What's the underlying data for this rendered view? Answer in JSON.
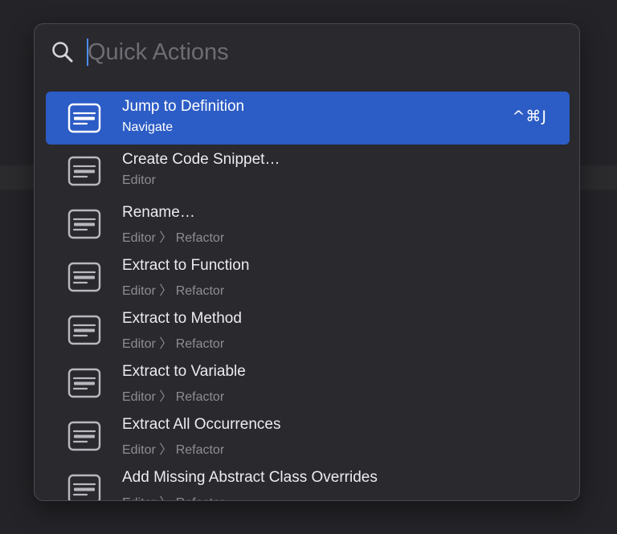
{
  "search": {
    "placeholder": "Quick Actions",
    "icon": "magnifier-icon"
  },
  "colors": {
    "selection": "#2c5cc5",
    "caret": "#4a8ef5",
    "panel": "#2a292e"
  },
  "items": [
    {
      "title": "Jump to Definition",
      "subtitle": "Navigate",
      "shortcut": "^⌘J",
      "selected": true,
      "icon": "command-icon"
    },
    {
      "title": "Create Code Snippet…",
      "subtitle": "Editor",
      "shortcut": "",
      "selected": false,
      "icon": "command-icon"
    },
    {
      "title": "Rename…",
      "subtitle": "Editor 〉 Refactor",
      "shortcut": "",
      "selected": false,
      "icon": "command-icon"
    },
    {
      "title": "Extract to Function",
      "subtitle": "Editor 〉 Refactor",
      "shortcut": "",
      "selected": false,
      "icon": "command-icon"
    },
    {
      "title": "Extract to Method",
      "subtitle": "Editor 〉 Refactor",
      "shortcut": "",
      "selected": false,
      "icon": "command-icon"
    },
    {
      "title": "Extract to Variable",
      "subtitle": "Editor 〉 Refactor",
      "shortcut": "",
      "selected": false,
      "icon": "command-icon"
    },
    {
      "title": "Extract All Occurrences",
      "subtitle": "Editor 〉 Refactor",
      "shortcut": "",
      "selected": false,
      "icon": "command-icon"
    },
    {
      "title": "Add Missing Abstract Class Overrides",
      "subtitle": "Editor 〉 Refactor",
      "shortcut": "",
      "selected": false,
      "icon": "command-icon"
    }
  ]
}
